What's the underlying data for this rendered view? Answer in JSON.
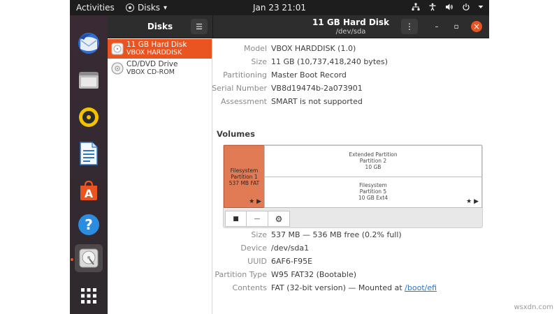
{
  "topbar": {
    "activities": "Activities",
    "app_name": "Disks",
    "app_menu_arrow": "▾",
    "clock": "Jan 23  21:01",
    "tray_icons": [
      "network-icon",
      "accessibility-icon",
      "volume-icon",
      "power-icon",
      "chevron-down-icon"
    ]
  },
  "dock": {
    "items": [
      {
        "icon": "thunderbird-icon"
      },
      {
        "icon": "files-icon"
      },
      {
        "icon": "rhythmbox-icon"
      },
      {
        "icon": "libreoffice-writer-icon"
      },
      {
        "icon": "software-store-icon"
      },
      {
        "icon": "help-icon"
      },
      {
        "icon": "disks-icon",
        "active": true
      },
      {
        "icon": "show-apps-icon"
      }
    ],
    "help_glyph": "?",
    "store_glyph": "A"
  },
  "headerbar": {
    "left_title": "Disks",
    "menu_glyph": "☰",
    "title": "11 GB Hard Disk",
    "subtitle": "/dev/sda",
    "dots_glyph": "⋮",
    "minimize_glyph": "–",
    "maximize_glyph": "▫",
    "close_glyph": "×"
  },
  "sidebar": {
    "drives": [
      {
        "name": "11 GB Hard Disk",
        "model": "VBOX HARDDISK",
        "selected": true
      },
      {
        "name": "CD/DVD Drive",
        "model": "VBOX CD-ROM",
        "selected": false
      }
    ]
  },
  "disk_info": [
    {
      "key": "Model",
      "value": "VBOX HARDDISK (1.0)"
    },
    {
      "key": "Size",
      "value": "11 GB (10,737,418,240 bytes)"
    },
    {
      "key": "Partitioning",
      "value": "Master Boot Record"
    },
    {
      "key": "Serial Number",
      "value": "VB8d19474b-2a073901"
    },
    {
      "key": "Assessment",
      "value": "SMART is not supported"
    }
  ],
  "volumes": {
    "title": "Volumes",
    "partitions": [
      {
        "lines": [
          "Filesystem",
          "Partition 1",
          "537 MB FAT"
        ],
        "selected": true,
        "stars": "★ ▶"
      },
      {
        "lines": [
          "Extended Partition",
          "Partition 2",
          "10 GB"
        ],
        "selected": false,
        "stars": ""
      },
      {
        "lines": [
          "Filesystem",
          "Partition 5",
          "10 GB Ext4"
        ],
        "selected": false,
        "stars": "★ ▶"
      }
    ],
    "tools": {
      "stop": "■",
      "minus": "—",
      "gears": "⚙"
    }
  },
  "volume_info": [
    {
      "key": "Size",
      "value": "537 MB — 536 MB free (0.2% full)"
    },
    {
      "key": "Device",
      "value": "/dev/sda1"
    },
    {
      "key": "UUID",
      "value": "6AF6-F95E"
    },
    {
      "key": "Partition Type",
      "value": "W95 FAT32 (Bootable)"
    },
    {
      "key": "Contents",
      "value": "FAT (32-bit version) — Mounted at ",
      "link": "/boot/efi"
    }
  ],
  "watermark": "wsxdn.com",
  "colors": {
    "accent": "#e95420",
    "topbar": "#1d1d1d",
    "headerbar": "#2d2d2d",
    "link": "#2a76c6"
  }
}
